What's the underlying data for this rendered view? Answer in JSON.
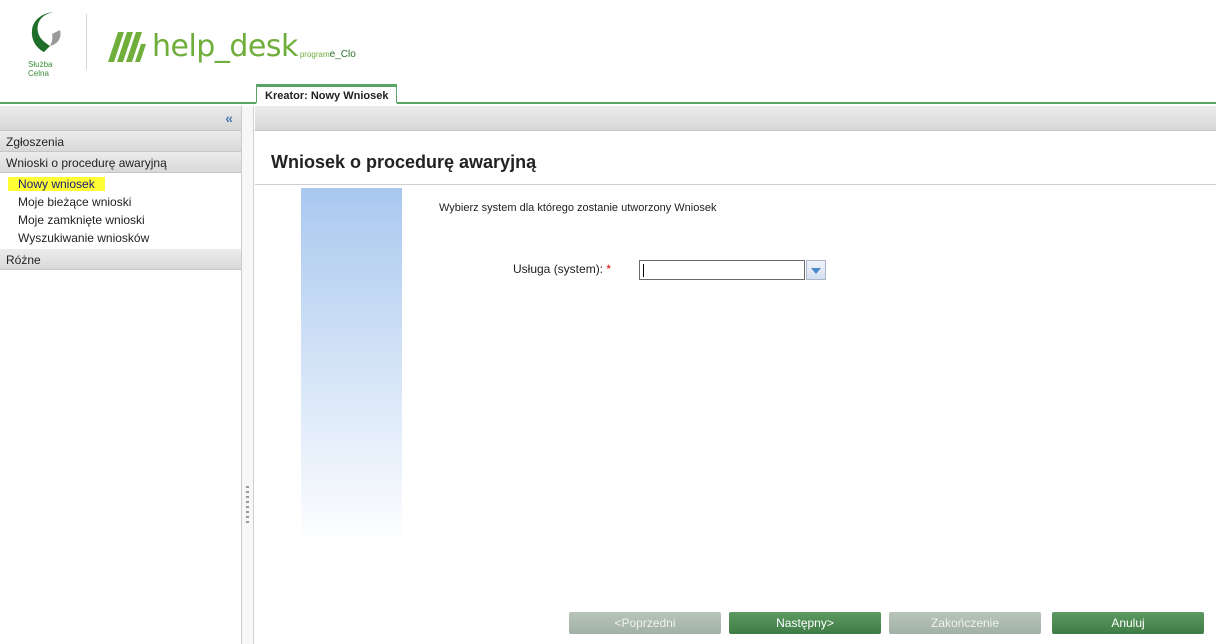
{
  "header": {
    "org_line1": "Służba",
    "org_line2": "Celna",
    "app_name": "help_desk",
    "app_sub_prefix": "program",
    "app_sub_brand": "e_Clo"
  },
  "tabs": [
    {
      "label": "Kreator: Nowy Wniosek",
      "active": true
    }
  ],
  "sidebar": {
    "collapse_label": "«",
    "sections": [
      {
        "label": "Zgłoszenia",
        "items": []
      },
      {
        "label": "Wnioski o procedurę awaryjną",
        "items": [
          {
            "label": "Nowy wniosek",
            "highlighted": true
          },
          {
            "label": "Moje bieżące wnioski"
          },
          {
            "label": "Moje zamknięte wnioski"
          },
          {
            "label": "Wyszukiwanie wniosków"
          }
        ]
      },
      {
        "label": "Różne",
        "items": []
      }
    ]
  },
  "main": {
    "title": "Wniosek o procedurę awaryjną",
    "instruction": "Wybierz system dla którego zostanie utworzony Wniosek",
    "field": {
      "label": "Usługa (system):",
      "required_marker": "*",
      "value": ""
    }
  },
  "footer": {
    "prev_label": "<Poprzedni",
    "next_label": "Następny>",
    "finish_label": "Zakończenie",
    "cancel_label": "Anuluj"
  },
  "colors": {
    "accent_green": "#5aa463",
    "button_green": "#4a8a50",
    "highlight_yellow": "#ffff33",
    "gradient_blue": "#a9c8ef"
  }
}
